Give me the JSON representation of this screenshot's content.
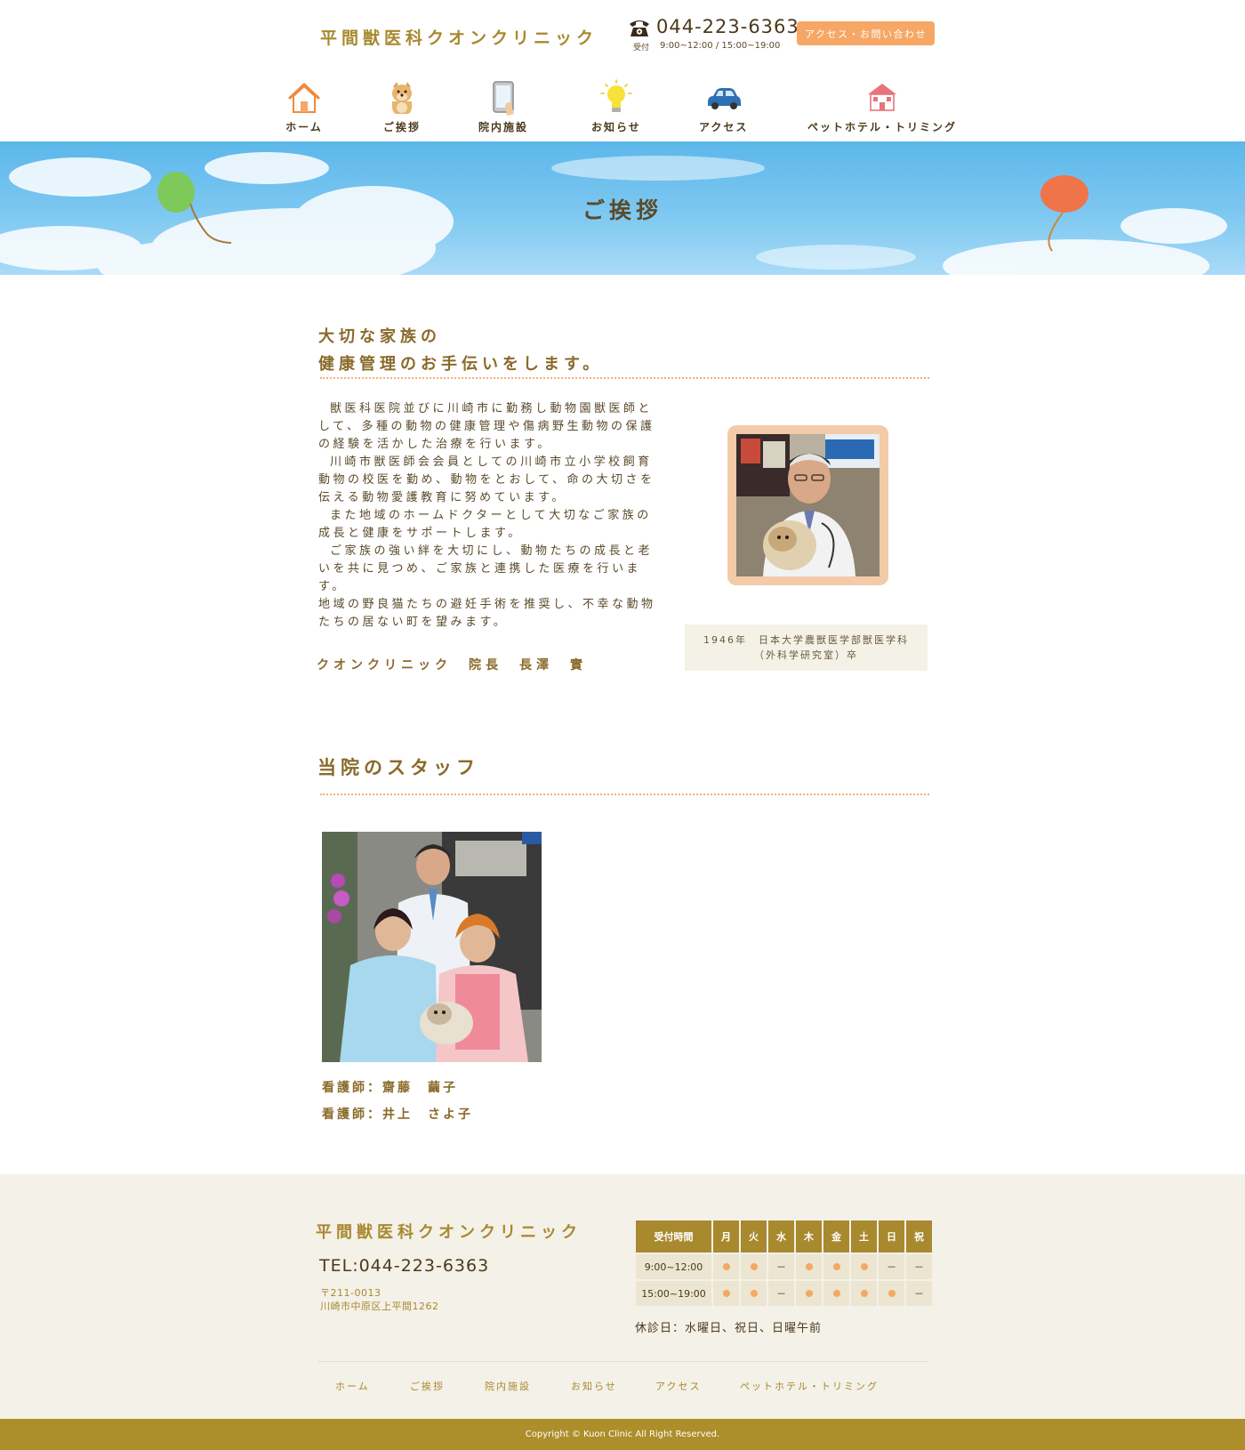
{
  "header": {
    "logo": "平間獣医科クオンクリニック",
    "phone": "044-223-6363",
    "hours_label": "受付",
    "hours_text": "9:00~12:00 / 15:00~19:00",
    "contact_button": "アクセス・お問い合わせ"
  },
  "nav": {
    "items": [
      {
        "label": "ホーム",
        "icon": "house-icon"
      },
      {
        "label": "ご挨拶",
        "icon": "dog-icon"
      },
      {
        "label": "院内施設",
        "icon": "tablet-icon"
      },
      {
        "label": "お知らせ",
        "icon": "lightbulb-icon"
      },
      {
        "label": "アクセス",
        "icon": "car-icon"
      },
      {
        "label": "ペットホテル・トリミング",
        "icon": "pet-hotel-icon"
      }
    ]
  },
  "banner": {
    "title": "ご挨拶"
  },
  "greeting": {
    "heading_line1": "大切な家族の",
    "heading_line2": "健康管理のお手伝いをします。",
    "paragraphs": [
      "獣医科医院並びに川崎市に勤務し動物園獣医師として、多種の動物の健康管理や傷病野生動物の保護の経験を活かした治療を行います。",
      "川崎市獣医師会会員としての川崎市立小学校飼育動物の校医を勤め、動物をとおして、命の大切さを伝える動物愛護教育に努めています。",
      "また地域のホームドクターとして大切なご家族の成長と健康をサポートします。",
      "ご家族の強い絆を大切にし、動物たちの成長と老いを共に見つめ、ご家族と連携した医療を行います。",
      "地域の野良猫たちの避妊手術を推奨し、不幸な動物たちの居ない町を望みます。"
    ],
    "signature": "クオンクリニック　院長　長澤　實",
    "career_line1": "1946年　日本大学農獣医学部獣医学科",
    "career_line2": "（外科学研究室）卒"
  },
  "staff": {
    "heading": "当院のスタッフ",
    "members": [
      "看護師：齋藤　繭子",
      "看護師：井上　さよ子"
    ]
  },
  "footer": {
    "logo": "平間獣医科クオンクリニック",
    "tel": "TEL:044-223-6363",
    "zip": "〒211-0013",
    "address": "川崎市中原区上平間1262",
    "table": {
      "header_time": "受付時間",
      "days": [
        "月",
        "火",
        "水",
        "木",
        "金",
        "土",
        "日",
        "祝"
      ],
      "rows": [
        {
          "time": "9:00~12:00",
          "open": [
            true,
            true,
            false,
            true,
            true,
            true,
            false,
            false
          ]
        },
        {
          "time": "15:00~19:00",
          "open": [
            true,
            true,
            false,
            true,
            true,
            true,
            true,
            false
          ]
        }
      ],
      "closed_mark": "－"
    },
    "closed_note": "休診日：水曜日、祝日、日曜午前",
    "nav": [
      "ホーム",
      "ご挨拶",
      "院内施設",
      "お知らせ",
      "アクセス",
      "ペットホテル・トリミング"
    ],
    "copyright": "Copyright © Kuon Clinic All Right Reserved."
  },
  "colors": {
    "accent": "#f6a765",
    "gold": "#a8892e",
    "footer_bg": "#f4f1e8",
    "copyright_bg": "#ac8e2b",
    "sky": "#6cc0ef"
  }
}
